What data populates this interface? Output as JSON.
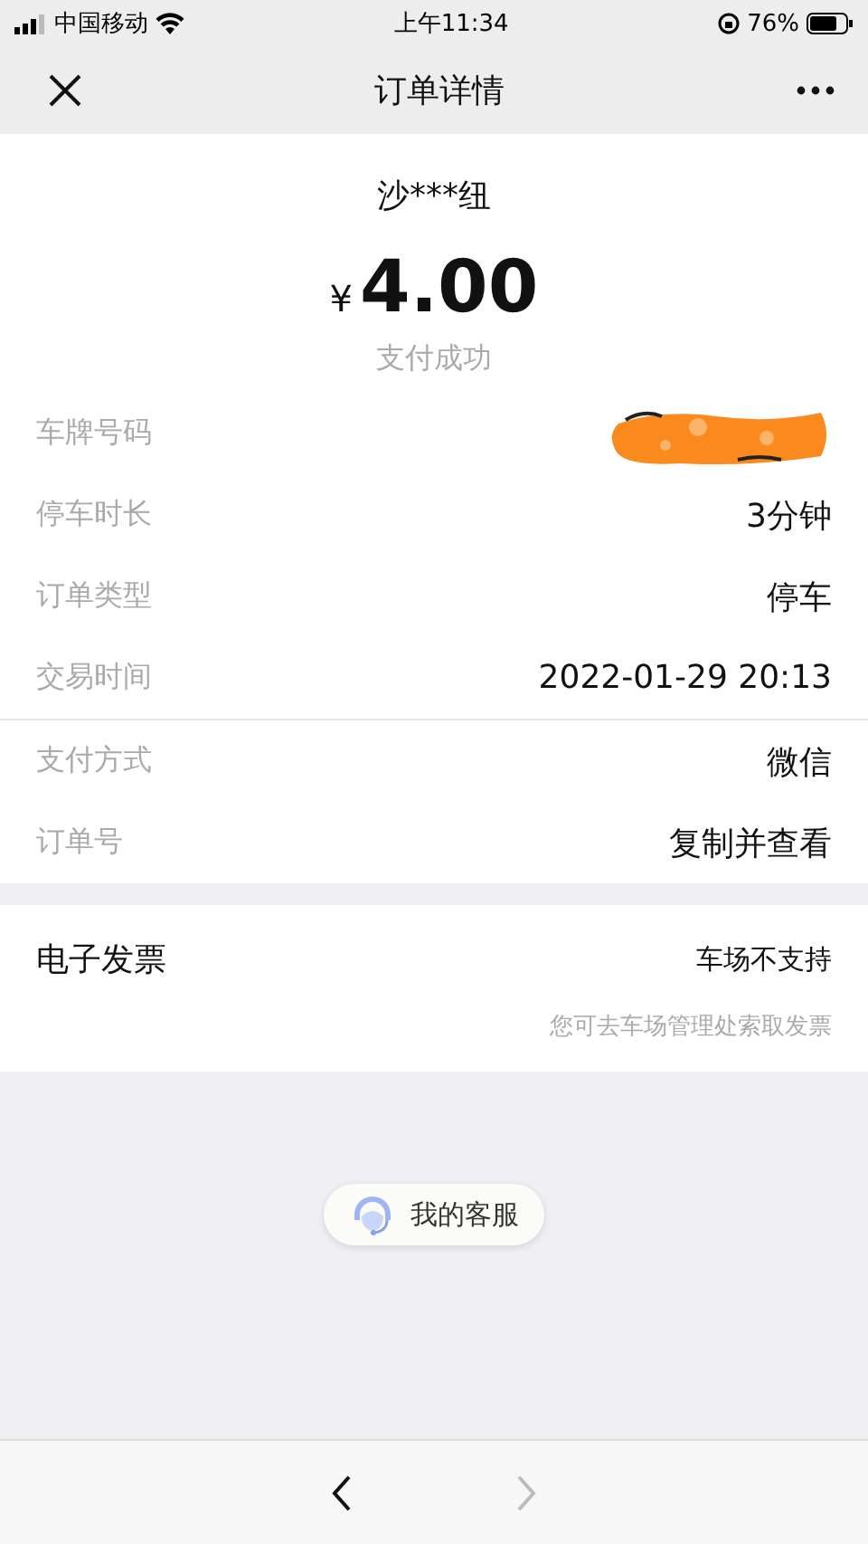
{
  "status_bar": {
    "carrier": "中国移动",
    "time": "上午11:34",
    "battery": "76%"
  },
  "nav": {
    "title": "订单详情"
  },
  "summary": {
    "merchant": "沙***纽",
    "currency": "¥",
    "amount": "4.00",
    "status": "支付成功"
  },
  "detail_groups": [
    [
      {
        "kind": "redacted",
        "label": "车牌号码"
      },
      {
        "kind": "text",
        "label": "停车时长",
        "value": "3分钟"
      },
      {
        "kind": "text",
        "label": "订单类型",
        "value": "停车"
      },
      {
        "kind": "text",
        "label": "交易时间",
        "value": "2022-01-29 20:13"
      }
    ],
    [
      {
        "kind": "text",
        "label": "支付方式",
        "value": "微信"
      },
      {
        "kind": "text",
        "label": "订单号",
        "value": "复制并查看"
      }
    ]
  ],
  "invoice": {
    "title": "电子发票",
    "value": "车场不支持",
    "hint": "您可去车场管理处索取发票"
  },
  "support_button": {
    "label": "我的客服"
  },
  "toolbar": {
    "back_disabled": false,
    "forward_disabled": true
  }
}
